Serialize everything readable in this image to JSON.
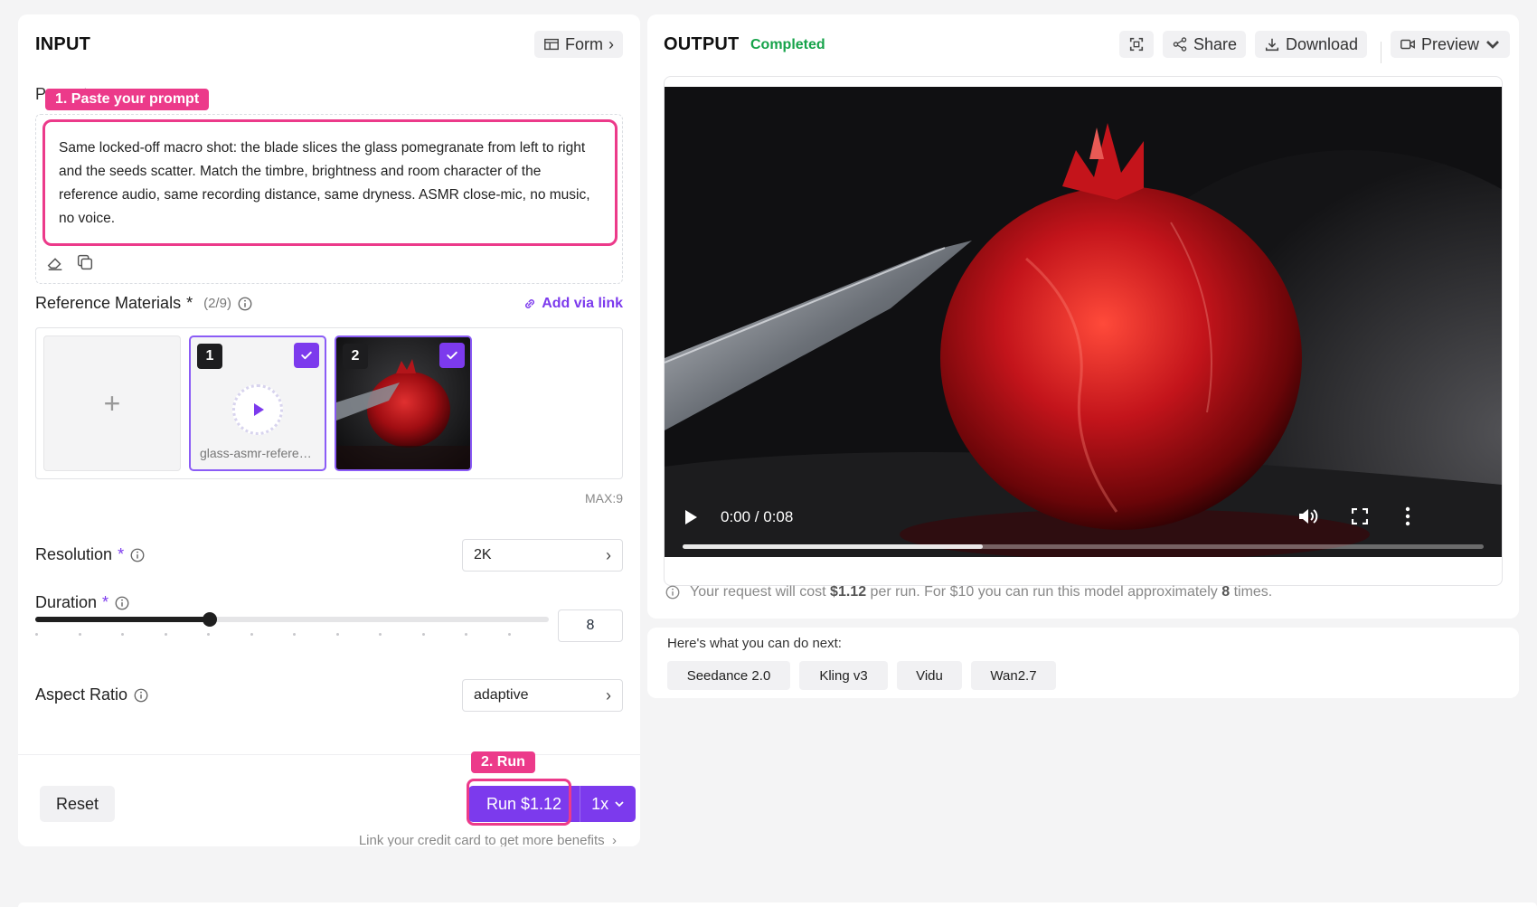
{
  "input": {
    "title": "INPUT",
    "form_button": "Form",
    "prompt_label": "Prompt",
    "prompt_text": "Same locked-off macro shot: the blade slices the glass pomegranate from left to right and the seeds scatter. Match the timbre, brightness and room character of the reference audio, same recording distance, same dryness. ASMR close-mic, no music, no voice.",
    "step1_tag": "1. Paste your prompt",
    "reference": {
      "label": "Reference Materials",
      "required_mark": "*",
      "count": "(2/9)",
      "add_link": "Add via link",
      "add_tile": "+",
      "items": [
        {
          "number": "1",
          "name": "glass-asmr-reference"
        },
        {
          "number": "2",
          "name": ""
        }
      ],
      "max_note": "MAX:9"
    },
    "resolution": {
      "label": "Resolution",
      "required_mark": "*",
      "value": "2K"
    },
    "duration": {
      "label": "Duration",
      "required_mark": "*",
      "value": "8",
      "slider_fraction": 0.34
    },
    "aspect_ratio": {
      "label": "Aspect Ratio",
      "value": "adaptive"
    },
    "reset_button": "Reset",
    "step2_tag": "2. Run",
    "run_button": "Run $1.12",
    "multiplier": "1x",
    "credit_note": "Link your credit card to get more benefits"
  },
  "output": {
    "title": "OUTPUT",
    "status": "Completed",
    "share_button": "Share",
    "download_button": "Download",
    "preview_button": "Preview",
    "video": {
      "time": "0:00 / 0:08",
      "progress_fraction": 0.375
    },
    "cost_note": {
      "prefix": "Your request will cost",
      "cost": "$1.12",
      "middle": "per run. For $10 you can run this model approximately",
      "times": "8",
      "suffix": "times."
    }
  },
  "next": {
    "title": "Here's what you can do next:",
    "models": [
      "Seedance 2.0",
      "Kling v3",
      "Vidu",
      "Wan2.7"
    ]
  },
  "colors": {
    "accent": "#7c3aed",
    "highlight": "#ec3a8a",
    "success": "#16a34a"
  }
}
